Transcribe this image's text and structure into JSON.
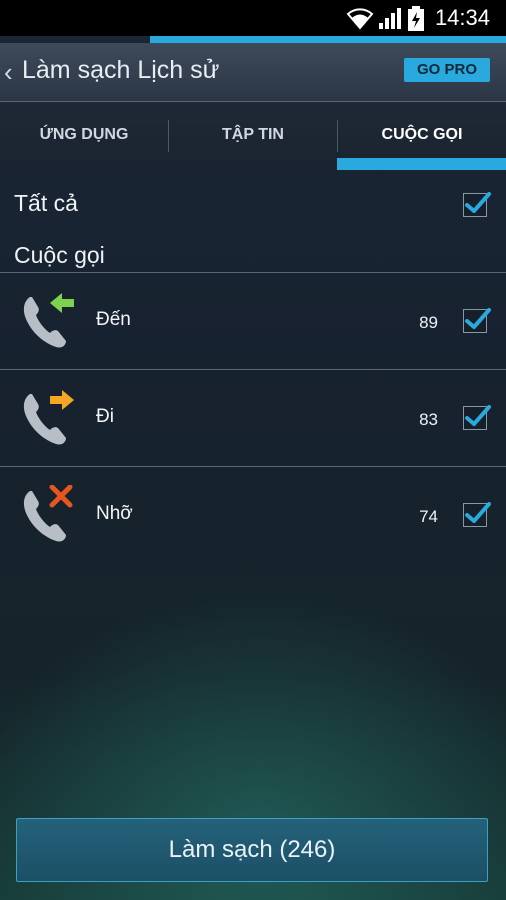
{
  "status": {
    "time": "14:34"
  },
  "header": {
    "title": "Làm sạch Lịch sử",
    "go_pro": "GO PRO"
  },
  "tabs": [
    {
      "label": "ỨNG DỤNG"
    },
    {
      "label": "TẬP TIN"
    },
    {
      "label": "CUỘC GỌI"
    }
  ],
  "select_all": {
    "label": "Tất cả",
    "checked": true
  },
  "section_title": "Cuộc gọi",
  "calls": [
    {
      "label": "Đến",
      "count": "89",
      "icon": "incoming-call-icon",
      "checked": true
    },
    {
      "label": "Đi",
      "count": "83",
      "icon": "outgoing-call-icon",
      "checked": true
    },
    {
      "label": "Nhỡ",
      "count": "74",
      "icon": "missed-call-icon",
      "checked": true
    }
  ],
  "action_button": "Làm sạch (246)",
  "colors": {
    "accent": "#2aa9de",
    "incoming": "#7ed34e",
    "outgoing": "#f5a623",
    "missed": "#e8551f"
  }
}
